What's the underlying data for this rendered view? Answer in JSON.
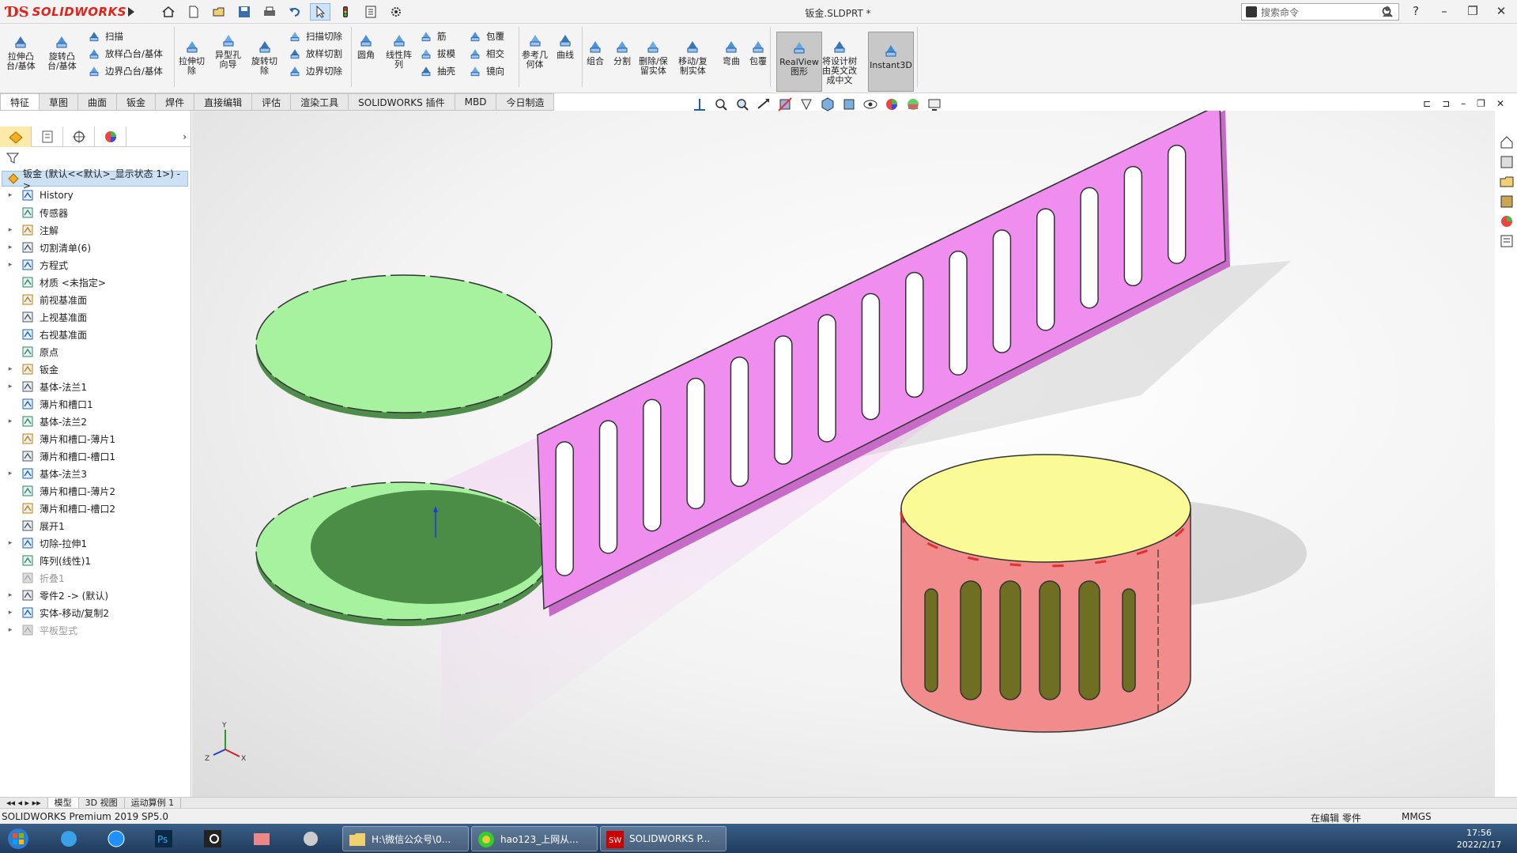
{
  "app": {
    "logo_text": "SOLIDWORKS",
    "document_title": "钣金.SLDPRT *",
    "search_placeholder": "搜索命令"
  },
  "ribbon": {
    "big_buttons": [
      {
        "id": "extrude-boss",
        "label": "拉伸凸\n台/基体"
      },
      {
        "id": "revolve-boss",
        "label": "旋转凸\n台/基体"
      },
      {
        "id": "extrude-cut",
        "label": "拉伸切\n除"
      },
      {
        "id": "hole-wizard",
        "label": "异型孔\n向导"
      },
      {
        "id": "revolve-cut",
        "label": "旋转切\n除"
      },
      {
        "id": "fillet",
        "label": "圆角"
      },
      {
        "id": "linear-pattern",
        "label": "线性阵\n列"
      },
      {
        "id": "ref-geometry",
        "label": "参考几\n何体"
      },
      {
        "id": "curves",
        "label": "曲线"
      },
      {
        "id": "combine",
        "label": "组合"
      },
      {
        "id": "split",
        "label": "分割"
      },
      {
        "id": "delete-keep",
        "label": "删除/保\n留实体"
      },
      {
        "id": "move-copy",
        "label": "移动/复\n制实体"
      },
      {
        "id": "flex",
        "label": "弯曲"
      },
      {
        "id": "wrap",
        "label": "包覆"
      },
      {
        "id": "realview",
        "label": "RealView\n图形"
      },
      {
        "id": "translate-tree",
        "label": "将设计树\n由英文改\n成中文"
      },
      {
        "id": "instant3d",
        "label": "Instant3D"
      }
    ],
    "small_buttons": [
      {
        "id": "sweep",
        "label": "扫描"
      },
      {
        "id": "loft-boss",
        "label": "放样凸台/基体"
      },
      {
        "id": "boundary-boss",
        "label": "边界凸台/基体"
      },
      {
        "id": "swept-cut",
        "label": "扫描切除"
      },
      {
        "id": "lofted-cut",
        "label": "放样切割"
      },
      {
        "id": "boundary-cut",
        "label": "边界切除"
      },
      {
        "id": "rib",
        "label": "筋"
      },
      {
        "id": "draft",
        "label": "拔模"
      },
      {
        "id": "shell",
        "label": "抽壳"
      },
      {
        "id": "wrap-small",
        "label": "包覆"
      },
      {
        "id": "intersect",
        "label": "相交"
      },
      {
        "id": "mirror",
        "label": "镜向"
      }
    ]
  },
  "tabs": [
    "特征",
    "草图",
    "曲面",
    "钣金",
    "焊件",
    "直接编辑",
    "评估",
    "渲染工具",
    "SOLIDWORKS 插件",
    "MBD",
    "今日制造"
  ],
  "tree": {
    "root": "钣金 (默认<<默认>_显示状态 1>) ->",
    "items": [
      {
        "label": "History",
        "expand": true,
        "dim": false
      },
      {
        "label": "传感器",
        "expand": false,
        "dim": false
      },
      {
        "label": "注解",
        "expand": true,
        "dim": false
      },
      {
        "label": "切割清单(6)",
        "expand": true,
        "dim": false
      },
      {
        "label": "方程式",
        "expand": true,
        "dim": false
      },
      {
        "label": "材质 <未指定>",
        "expand": false,
        "dim": false
      },
      {
        "label": "前视基准面",
        "expand": false,
        "dim": false
      },
      {
        "label": "上视基准面",
        "expand": false,
        "dim": false
      },
      {
        "label": "右视基准面",
        "expand": false,
        "dim": false
      },
      {
        "label": "原点",
        "expand": false,
        "dim": false
      },
      {
        "label": "钣金",
        "expand": true,
        "dim": false
      },
      {
        "label": "基体-法兰1",
        "expand": true,
        "dim": false
      },
      {
        "label": "薄片和槽口1",
        "expand": false,
        "dim": false
      },
      {
        "label": "基体-法兰2",
        "expand": true,
        "dim": false
      },
      {
        "label": "薄片和槽口-薄片1",
        "expand": false,
        "dim": false
      },
      {
        "label": "薄片和槽口-槽口1",
        "expand": false,
        "dim": false
      },
      {
        "label": "基体-法兰3",
        "expand": true,
        "dim": false
      },
      {
        "label": "薄片和槽口-薄片2",
        "expand": false,
        "dim": false
      },
      {
        "label": "薄片和槽口-槽口2",
        "expand": false,
        "dim": false
      },
      {
        "label": "展开1",
        "expand": false,
        "dim": false
      },
      {
        "label": "切除-拉伸1",
        "expand": true,
        "dim": false
      },
      {
        "label": "阵列(线性)1",
        "expand": false,
        "dim": false
      },
      {
        "label": "折叠1",
        "expand": false,
        "dim": true
      },
      {
        "label": "零件2 -> (默认)",
        "expand": true,
        "dim": false
      },
      {
        "label": "实体-移动/复制2",
        "expand": true,
        "dim": false
      },
      {
        "label": "平板型式",
        "expand": true,
        "dim": true
      }
    ]
  },
  "bottom_tabs": [
    "模型",
    "3D 视图",
    "运动算例 1"
  ],
  "status": {
    "product": "SOLIDWORKS Premium 2019 SP5.0",
    "editing": "在编辑 零件",
    "units": "MMGS"
  },
  "taskbar": {
    "windows": [
      {
        "label": "H:\\微信公众号\\0..."
      },
      {
        "label": "hao123_上网从..."
      },
      {
        "label": "SOLIDWORKS P..."
      }
    ],
    "time": "17:56",
    "date": "2022/2/17"
  },
  "colors": {
    "plate_green": "#a6f29e",
    "panel_pink": "#f08ef0",
    "cylinder_red": "#f28b8b",
    "cylinder_top": "#fafa96",
    "accent_blue": "#1d79c8"
  }
}
